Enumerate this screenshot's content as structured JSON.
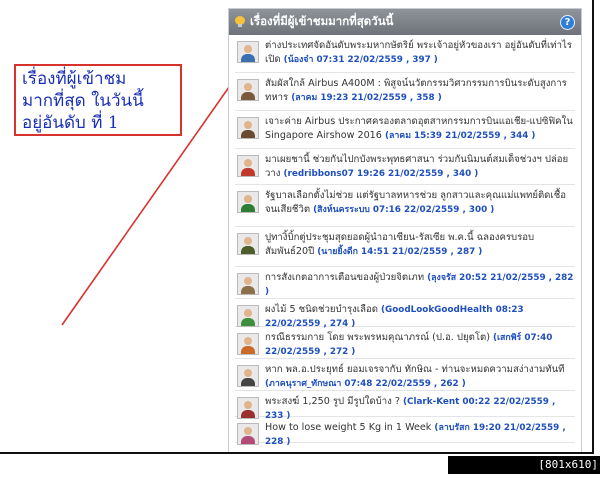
{
  "callout": {
    "lines": [
      "เรื่องที่ผู้เข้าชม",
      "มากที่สุด  ในวันนี้",
      "อยู่อันดับ  ที่  1"
    ]
  },
  "panel": {
    "title": "เรื่องที่มีผู้เข้าชมมากที่สุดวันนี้",
    "help_symbol": "?"
  },
  "items": [
    {
      "text": "ต่างประเทศจัดอันดับพระมหากษัตริย์ พระเจ้าอยู่หัวของเรา อยู่อันดับที่เท่าไร เปิด",
      "meta": "(น้องจ๋า 07:31 22/02/2559 , 397 )",
      "avatar": "#3b6fb0"
    },
    {
      "text": "สัมผัสใกล้ Airbus A400M : พิสูจน์นวัตกรรมวิศวกรรมการบินระดับสูงการทหาร",
      "meta": "(ลาคม 19:23 21/02/2559 , 358 )",
      "avatar": "#7a5a3a"
    },
    {
      "text": "เจาะค่าย Airbus ประกาศครองตลาดอุตสาหกรรมการบินแอเชีย-แปซิฟิคใน Singapore Airshow 2016",
      "meta": "(ลาคม 15:39 21/02/2559 , 344 )",
      "avatar": "#6a4a30"
    },
    {
      "text": "มาเผยชานี้ ช่วยกันไปกบังพระพุทธศาสนา ร่วมกันนิมนต์สมเด็จช่วงฯ ปล่อยวาง",
      "meta": "(redribbons07 19:26 21/02/2559 , 340 )",
      "avatar": "#c0392b"
    },
    {
      "text": "รัฐบาลเลือกตั้งไม่ช่วย แต่รัฐบาลทหารช่วย ลูกสาวและคุณแม่แพทย์ติดเชื้อจนเสียชีวิต",
      "meta": "(สิงห์นครระบบ 07:16 22/02/2559 , 300 )",
      "avatar": "#2e7d32"
    },
    {
      "text": "ปูทางิ้บิ้กตู่ประชุมสุดยอดผู้นำอาเซียน-รัสเซีย พ.ค.นี้ ฉลองครบรอบสัมพันธ์20ปี",
      "meta": "(นายยิ้งดีก 14:51 21/02/2559 , 287 )",
      "avatar": "#4e5d2a"
    },
    {
      "text": "การสังเกตอาการเตือนของผู้ป่วยจิตเภท",
      "meta": "(ลุงจรัส 20:52 21/02/2559 , 282 )",
      "avatar": "#8d6e4a"
    },
    {
      "text": "ผงไม้ 5 ชนิดช่วยบำรุงเลือด",
      "meta": "(GoodLookGoodHealth 08:23 22/02/2559 , 274 )",
      "avatar": "#3d8f3d"
    },
    {
      "text": "กรณีธรรมกาย โดย พระพรหมคุณาภรณ์ (ป.อ. ปยุตโต)",
      "meta": "(เสกพิร์ 07:40 22/02/2559 , 272 )",
      "avatar": "#c96a2a"
    },
    {
      "text": "หาก พล.อ.ประยุทธ์ ยอมเจรจากับ ทักษิณ - ท่านจะหมดความสง่างามทันที",
      "meta": "(ภาคนุราศ_ทักษณา 07:48 22/02/2559 , 262 )",
      "avatar": "#444444"
    },
    {
      "text": "พระสงฆ์ 1,250 รูป มีรูปใดบ้าง ?",
      "meta": "(Clark-Kent 00:22 22/02/2559 , 233 )",
      "avatar": "#9a2f2f"
    },
    {
      "text": "How to lose weight 5 Kg in 1 Week",
      "meta": "(ลาบรัสก 19:20 21/02/2559 , 228 )",
      "avatar": "#b24a7a"
    }
  ],
  "watermark": "[801x610] http://upic.me/"
}
